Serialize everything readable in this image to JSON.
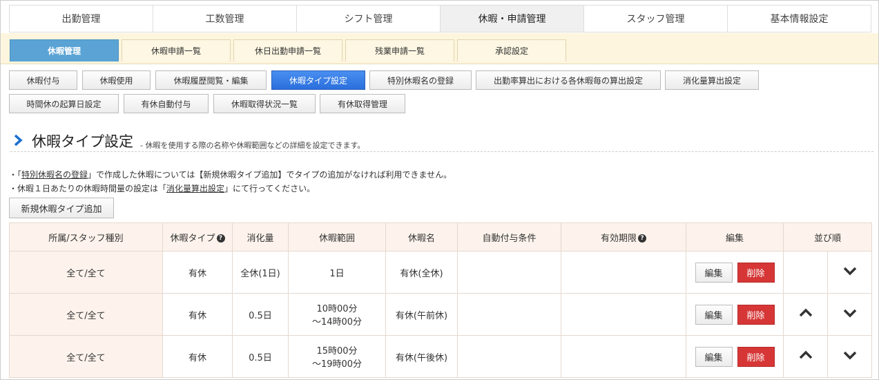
{
  "top_tabs": [
    "出勤管理",
    "工数管理",
    "シフト管理",
    "休暇・申請管理",
    "スタッフ管理",
    "基本情報設定"
  ],
  "sub_tabs": [
    "休暇管理",
    "休暇申請一覧",
    "休日出勤申請一覧",
    "残業申請一覧",
    "承認設定"
  ],
  "actions_row1": [
    "休暇付与",
    "休暇使用",
    "休暇履歴閲覧・編集",
    "休暇タイプ設定",
    "特別休暇名の登録",
    "出勤率算出における各休暇毎の算出設定",
    "消化量算出設定"
  ],
  "actions_row2": [
    "時間休の起算日設定",
    "有休自動付与",
    "休暇取得状況一覧",
    "有休取得管理"
  ],
  "heading": {
    "title": "休暇タイプ設定",
    "desc": "- 休暇を使用する際の名称や休暇範囲などの詳細を設定できます。"
  },
  "notes": {
    "n1_pre": "・「",
    "n1_link": "特別休暇名の登録",
    "n1_post": "」で作成した休暇については【新規休暇タイプ追加】でタイプの追加がなければ利用できません。",
    "n2_pre": "・休暇１日あたりの休暇時間量の設定は「",
    "n2_link": "消化量算出設定",
    "n2_post": "」にて行ってください。"
  },
  "add_button": "新規休暇タイプ追加",
  "table": {
    "headers": [
      "所属/スタッフ種別",
      "休暇タイプ",
      "消化量",
      "休暇範囲",
      "休暇名",
      "自動付与条件",
      "有効期限",
      "編集",
      "並び順"
    ],
    "edit_label": "編集",
    "delete_label": "削除",
    "rows": [
      {
        "scope": "全て/全て",
        "type": "有休",
        "amount": "全休(1日)",
        "range1": "1日",
        "range2": "",
        "name": "有休(全休)",
        "auto": "",
        "expiry": ""
      },
      {
        "scope": "全て/全て",
        "type": "有休",
        "amount": "0.5日",
        "range1": "10時00分",
        "range2": "～14時00分",
        "name": "有休(午前休)",
        "auto": "",
        "expiry": ""
      },
      {
        "scope": "全て/全て",
        "type": "有休",
        "amount": "0.5日",
        "range1": "15時00分",
        "range2": "～19時00分",
        "name": "有休(午後休)",
        "auto": "",
        "expiry": ""
      }
    ]
  },
  "colors": {
    "active_sub": "#5aa3d4",
    "active_action": "#2a6fdc",
    "delete": "#d63636",
    "accent": "#1a6fd0"
  }
}
